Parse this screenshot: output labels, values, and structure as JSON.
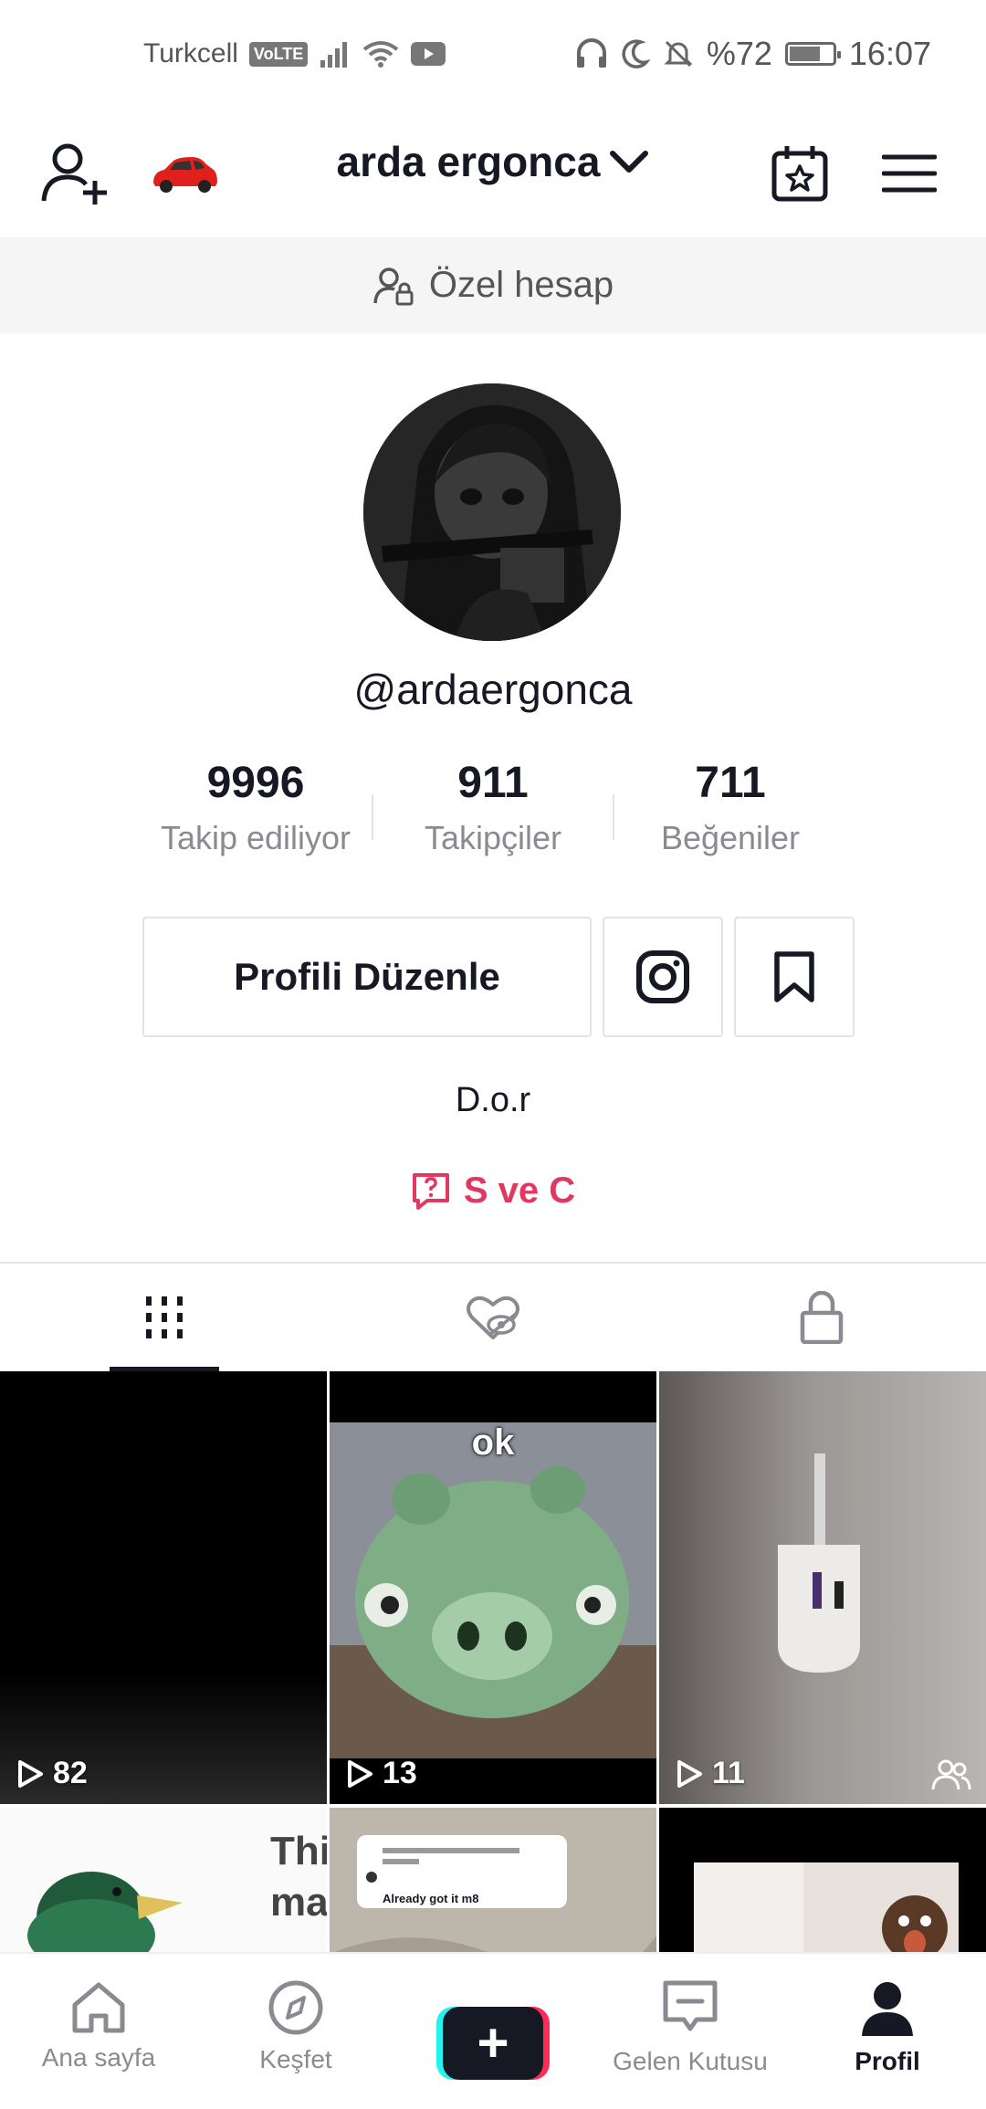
{
  "status_bar": {
    "carrier": "Turkcell",
    "volte": "VoLTE",
    "battery": "%72",
    "battery_level": 0.72,
    "time": "16:07"
  },
  "header": {
    "username": "arda ergonca",
    "icons": [
      "add-user-icon",
      "car-emoji-icon",
      "chevron-down-icon",
      "calendar-star-icon",
      "menu-icon"
    ]
  },
  "private_banner": {
    "text": "Özel hesap",
    "icon": "lock-user-icon"
  },
  "profile": {
    "handle": "@ardaergonca",
    "stats": [
      {
        "value": "9996",
        "label": "Takip ediliyor"
      },
      {
        "value": "911",
        "label": "Takipçiler"
      },
      {
        "value": "711",
        "label": "Beğeniler"
      }
    ],
    "edit_button": "Profili Düzenle",
    "bio": "D.o.r",
    "qa_link": "S ve C"
  },
  "tabs": [
    {
      "icon": "grid-icon",
      "active": true
    },
    {
      "icon": "liked-hidden-icon",
      "active": false
    },
    {
      "icon": "lock-icon",
      "active": false
    }
  ],
  "videos": [
    {
      "views": "82",
      "friends_only": false
    },
    {
      "views": "13",
      "friends_only": false,
      "caption": "ok"
    },
    {
      "views": "11",
      "friends_only": true
    },
    {
      "caption": "Thi ma"
    },
    {
      "caption": "Already got it m8"
    },
    {
      "caption": ""
    }
  ],
  "bottom_nav": [
    {
      "label": "Ana sayfa",
      "icon": "home-icon",
      "active": false
    },
    {
      "label": "Keşfet",
      "icon": "compass-icon",
      "active": false
    },
    {
      "label": "",
      "icon": "plus-icon",
      "active": false
    },
    {
      "label": "Gelen Kutusu",
      "icon": "inbox-icon",
      "active": false
    },
    {
      "label": "Profil",
      "icon": "profile-icon",
      "active": true
    }
  ],
  "colors": {
    "accent": "#e2375f",
    "text": "#161823",
    "muted": "#8a8b91"
  }
}
